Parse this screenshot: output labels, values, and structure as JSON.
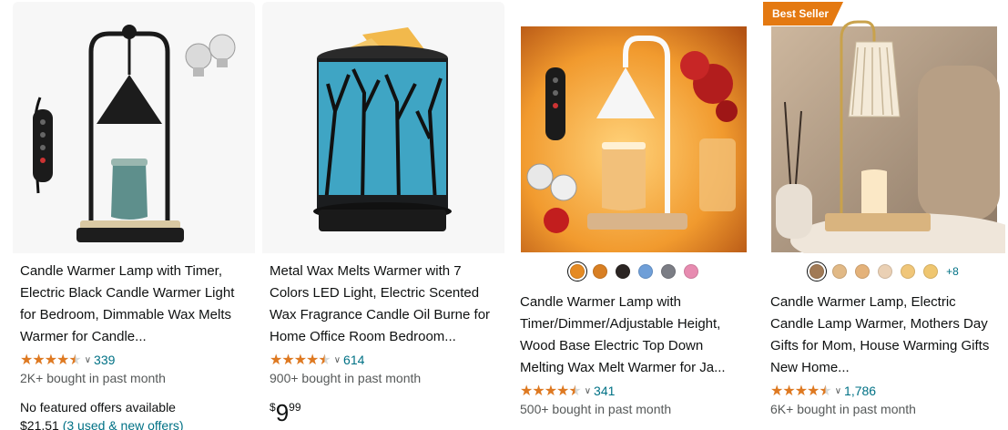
{
  "cards": [
    {
      "title": "Candle Warmer Lamp with Timer, Electric Black Candle Warmer Light for Bedroom, Dimmable Wax Melts Warmer for Candle...",
      "stars": "★★★★",
      "star_half": "★",
      "review_count": "339",
      "bought": "2K+ bought in past month",
      "no_offer": "No featured offers available",
      "offer_price": "$21.51",
      "offer_link": "(3 used & new offers)",
      "rating_value": 4.5
    },
    {
      "title": "Metal Wax Melts Warmer with 7 Colors LED Light, Electric Scented Wax Fragrance Candle Oil Burne for Home Office Room Bedroom...",
      "stars": "★★★★",
      "star_half": "★",
      "review_count": "614",
      "bought": "900+ bought in past month",
      "price_symbol": "$",
      "price_whole": "9",
      "price_fraction": "99",
      "rating_value": 4.5
    },
    {
      "title": "Candle Warmer Lamp with Timer/Dimmer/Adjustable Height, Wood Base Electric Top Down Melting Wax Melt Warmer for Ja...",
      "stars": "★★★★",
      "star_half": "★",
      "review_count": "341",
      "bought": "500+ bought in past month",
      "swatch_colors": [
        "#e58a22",
        "#d87f23",
        "#2b2523",
        "#6f9fd8",
        "#7b7d85",
        "#e78bb0"
      ],
      "rating_value": 4.5
    },
    {
      "badge": "Best Seller",
      "title": "Candle Warmer Lamp, Electric Candle Lamp Warmer, Mothers Day Gifts for Mom, House Warming Gifts New Home...",
      "stars": "★★★★",
      "star_half": "★",
      "review_count": "1,786",
      "bought": "6K+ bought in past month",
      "swatch_colors": [
        "#a17a55",
        "#e1b986",
        "#e4b27a",
        "#ead0b4",
        "#f0c679",
        "#efc670"
      ],
      "more_swatches": "+8",
      "rating_value": 4.5
    }
  ],
  "colors": {
    "link": "#007185",
    "star": "#de7921",
    "badge": "#e47911",
    "muted_text": "#565959"
  },
  "icons": [
    "chevron-down-icon",
    "star-icon"
  ]
}
